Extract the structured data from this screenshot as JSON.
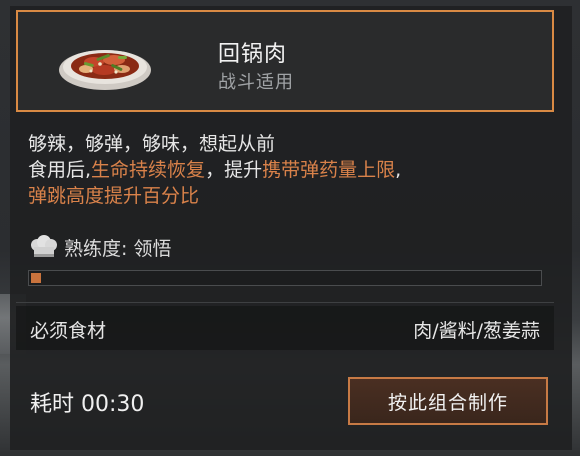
{
  "dish": {
    "name": "回锅肉",
    "category": "战斗适用",
    "image_icon": "twice-cooked-pork-dish-icon"
  },
  "description": {
    "line1": "够辣，够弹，够味，想起从前",
    "line2_pre": "食用后,",
    "line2_hl1": "生命持续恢复",
    "line2_mid": "，提升",
    "line2_hl2": "携带弹药量上限",
    "line2_post": ",",
    "line3_hl": "弹跳高度提升百分比"
  },
  "mastery": {
    "icon": "chef-hat-icon",
    "text": "熟练度: 领悟",
    "progress": 0.02
  },
  "ingredients": {
    "label": "必须食材",
    "value": "肉/酱料/葱姜蒜"
  },
  "cook_time": "耗时 00:30",
  "craft_button": "按此组合制作",
  "colors": {
    "accent": "#d98a44",
    "highlight": "#d9824a",
    "text": "#e6e6e6"
  }
}
